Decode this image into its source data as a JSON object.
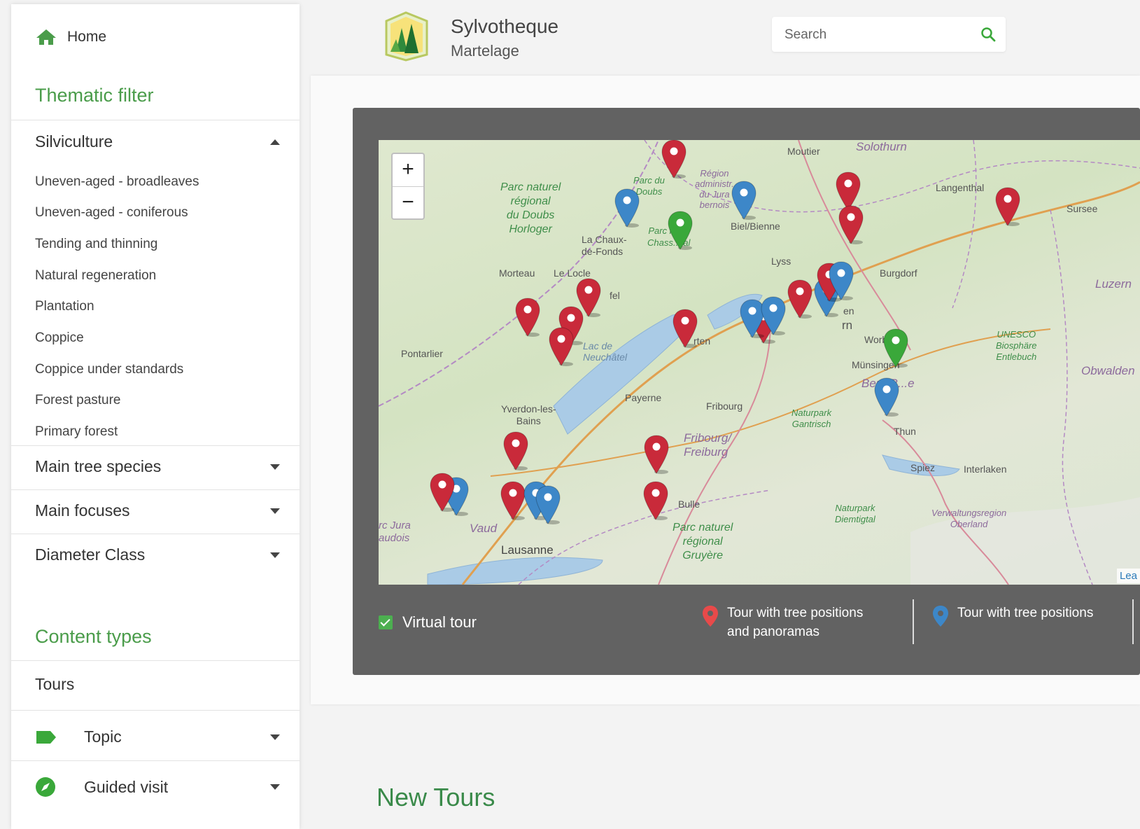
{
  "sidebar": {
    "home_label": "Home",
    "thematic_title": "Thematic filter",
    "silviculture": {
      "label": "Silviculture",
      "items": [
        "Uneven-aged - broadleaves",
        "Uneven-aged - coniferous",
        "Tending and thinning",
        "Natural regeneration",
        "Plantation",
        "Coppice",
        "Coppice under standards",
        "Forest pasture",
        "Primary forest"
      ]
    },
    "filters": [
      "Main tree species",
      "Main focuses",
      "Diameter Class"
    ],
    "content_types_title": "Content types",
    "tours_label": "Tours",
    "topic_label": "Topic",
    "guided_visit_label": "Guided visit"
  },
  "header": {
    "title": "Sylvotheque",
    "subtitle": "Martelage",
    "search_placeholder": "Search"
  },
  "map": {
    "zoom_in": "+",
    "zoom_out": "−",
    "attribution": "Lea",
    "labels": {
      "moutier": "Moutier",
      "solothurn": "Solothurn",
      "langenthal": "Langenthal",
      "sursee": "Sursee",
      "luzern": "Luzern",
      "burgdorf": "Burgdorf",
      "lyss": "Lyss",
      "biel": "Biel/Bienne",
      "la_chaux": "La Chaux-\nde-Fonds",
      "morteau": "Morteau",
      "le_locle": "Le Locle",
      "pontarlier": "Pontarlier",
      "payerne": "Payerne",
      "fribourg": "Fribourg",
      "yverdon": "Yverdon-les-\nBains",
      "lausanne": "Lausanne",
      "vaud": "Vaud",
      "worb": "Worb",
      "munsingen": "Münsingen",
      "thun": "Thun",
      "spiez": "Spiez",
      "interlaken": "Interlaken",
      "bulle": "Bulle",
      "obwalden": "Obwalden",
      "park_doubs": "Parc naturel\nrégional\ndu Doubs\nHorloger",
      "park_doubs2": "Parc du\nDoubs",
      "region_admin": "Région\nadministr.\ndu Jura\nbernois",
      "park_chasseral": "Parc r... al\nChass... al",
      "park_gantrisch": "Naturpark\nGantrisch",
      "park_gruyere": "Parc naturel\nrégional\nGruyère",
      "park_diemtigtal": "Naturpark\nDiemtigtal",
      "unesco": "UNESCO\nBiosphäre\nEntlebuch",
      "verwaltung": "Verwaltungsregion\nOberland",
      "jura_vaudois": "rc Jura\naudois",
      "lac_neuchatel": "Lac de\nNeuchâtel",
      "fribourg_region": "Fribourg/\nFreiburg",
      "bern_region": "Bern/B...e",
      "rten": "rten",
      "rn": "rn",
      "en": "en",
      "fel": "fel"
    },
    "markers": [
      {
        "color": "red"
      },
      {
        "color": "blue"
      },
      {
        "color": "green"
      },
      {
        "color": "blue"
      },
      {
        "color": "red"
      },
      {
        "color": "red"
      },
      {
        "color": "red"
      },
      {
        "color": "red"
      },
      {
        "color": "red"
      },
      {
        "color": "red"
      },
      {
        "color": "red"
      },
      {
        "color": "red"
      },
      {
        "color": "red"
      },
      {
        "color": "blue"
      },
      {
        "color": "blue"
      },
      {
        "color": "red"
      },
      {
        "color": "blue"
      },
      {
        "color": "red"
      },
      {
        "color": "blue"
      },
      {
        "color": "green"
      },
      {
        "color": "blue"
      },
      {
        "color": "red"
      },
      {
        "color": "red"
      },
      {
        "color": "blue"
      },
      {
        "color": "red"
      },
      {
        "color": "red"
      },
      {
        "color": "blue"
      },
      {
        "color": "blue"
      },
      {
        "color": "red"
      }
    ]
  },
  "legend": {
    "virtual_tour": "Virtual tour",
    "tour_positions_panoramas": "Tour with tree positions\nand panoramas",
    "tour_positions": "Tour with tree positions"
  },
  "main": {
    "new_tours_title": "New Tours"
  },
  "colors": {
    "accent_green": "#4a9c4a",
    "marker_red": "#c92a3a",
    "marker_blue": "#3d87c8",
    "marker_green": "#3aa83a"
  }
}
